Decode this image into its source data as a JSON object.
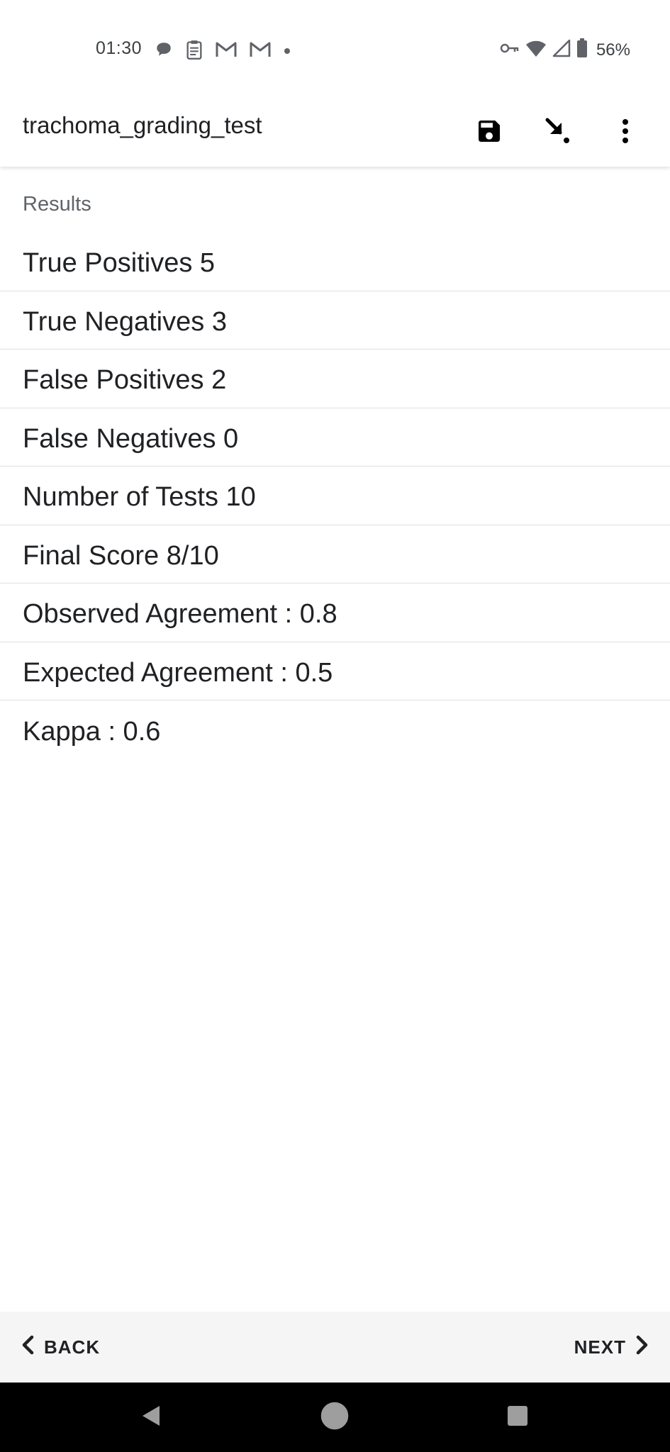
{
  "status_bar": {
    "time": "01:30",
    "battery": "56%",
    "left_icons": [
      "chat-bubble-icon",
      "clipboard-icon",
      "gmail-icon",
      "gmail-icon",
      "dot-icon"
    ],
    "right_icons": [
      "vpn-key-icon",
      "wifi-icon",
      "cell-signal-icon",
      "battery-icon"
    ]
  },
  "app_bar": {
    "title": "trachoma_grading_test",
    "actions": [
      "save-icon",
      "jump-arrow-icon",
      "more-vert-icon"
    ]
  },
  "results": {
    "section_label": "Results",
    "items": [
      "True Positives 5",
      "True Negatives 3",
      "False Positives 2",
      "False Negatives 0",
      "Number of Tests 10",
      "Final Score 8/10",
      "Observed Agreement : 0.8",
      "Expected Agreement : 0.5",
      "Kappa : 0.6"
    ]
  },
  "bottom_nav": {
    "back_label": "BACK",
    "next_label": "NEXT"
  },
  "colors": {
    "text_primary": "#202124",
    "text_secondary": "#5f6368",
    "divider": "#e0e0e0",
    "bottom_nav_bg": "#f5f5f5",
    "system_nav_bg": "#000000"
  }
}
